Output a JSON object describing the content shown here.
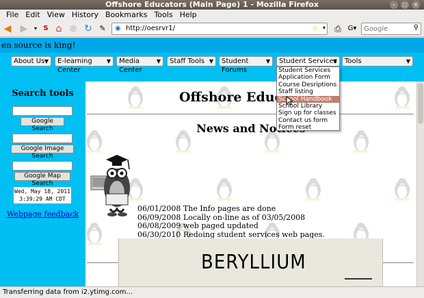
{
  "window": {
    "title": "Offshore Educators (Main Page) 1 - Mozilla Firefox"
  },
  "menubar": [
    "File",
    "Edit",
    "View",
    "History",
    "Bookmarks",
    "Tools",
    "Help"
  ],
  "navbar": {
    "url": "http://oesrvr1/",
    "search_placeholder": "Google"
  },
  "page": {
    "marquee": "en source is king!",
    "nav_selects": [
      {
        "label": "About Us"
      },
      {
        "label": "E-learning Center"
      },
      {
        "label": "Media Center"
      },
      {
        "label": "Staff Tools"
      },
      {
        "label": "Student Forums"
      },
      {
        "label": "Student Services"
      },
      {
        "label": "Tools"
      }
    ],
    "dropdown_items": [
      "Student Services",
      "Application Form",
      "Course Desriptions",
      "Staff listing",
      "School Handbook",
      "School Library",
      "Sign up for classes",
      "Contact us form",
      "Form reset"
    ],
    "dropdown_highlight_index": 4,
    "sidebar": {
      "heading": "Search tools",
      "google_search": "Google Search",
      "google_image_search": "Google Image Search",
      "google_map_search": "Google Map Search",
      "clock_line1": "Wed, May 18, 2011",
      "clock_line2": "3:39:29 AM CDT",
      "feedback": "Webpage feedback"
    },
    "content": {
      "title": "Offshore Educ",
      "news_heading": "News and Notices",
      "news": [
        "06/01/2008 The Info pages are done",
        "06/09/2008 Locally on-line as of 03/05/2008",
        "06/08/2009 web paged updated",
        "06/30/2010 Redoing student services web pages."
      ],
      "banner_text": "BERYLLIUM"
    }
  },
  "statusbar": {
    "text": "Transferring data from i2.ytimg.com..."
  },
  "colors": {
    "banner": "#00a8e8",
    "nav": "#00bff3",
    "highlight": "#c27f6f"
  }
}
